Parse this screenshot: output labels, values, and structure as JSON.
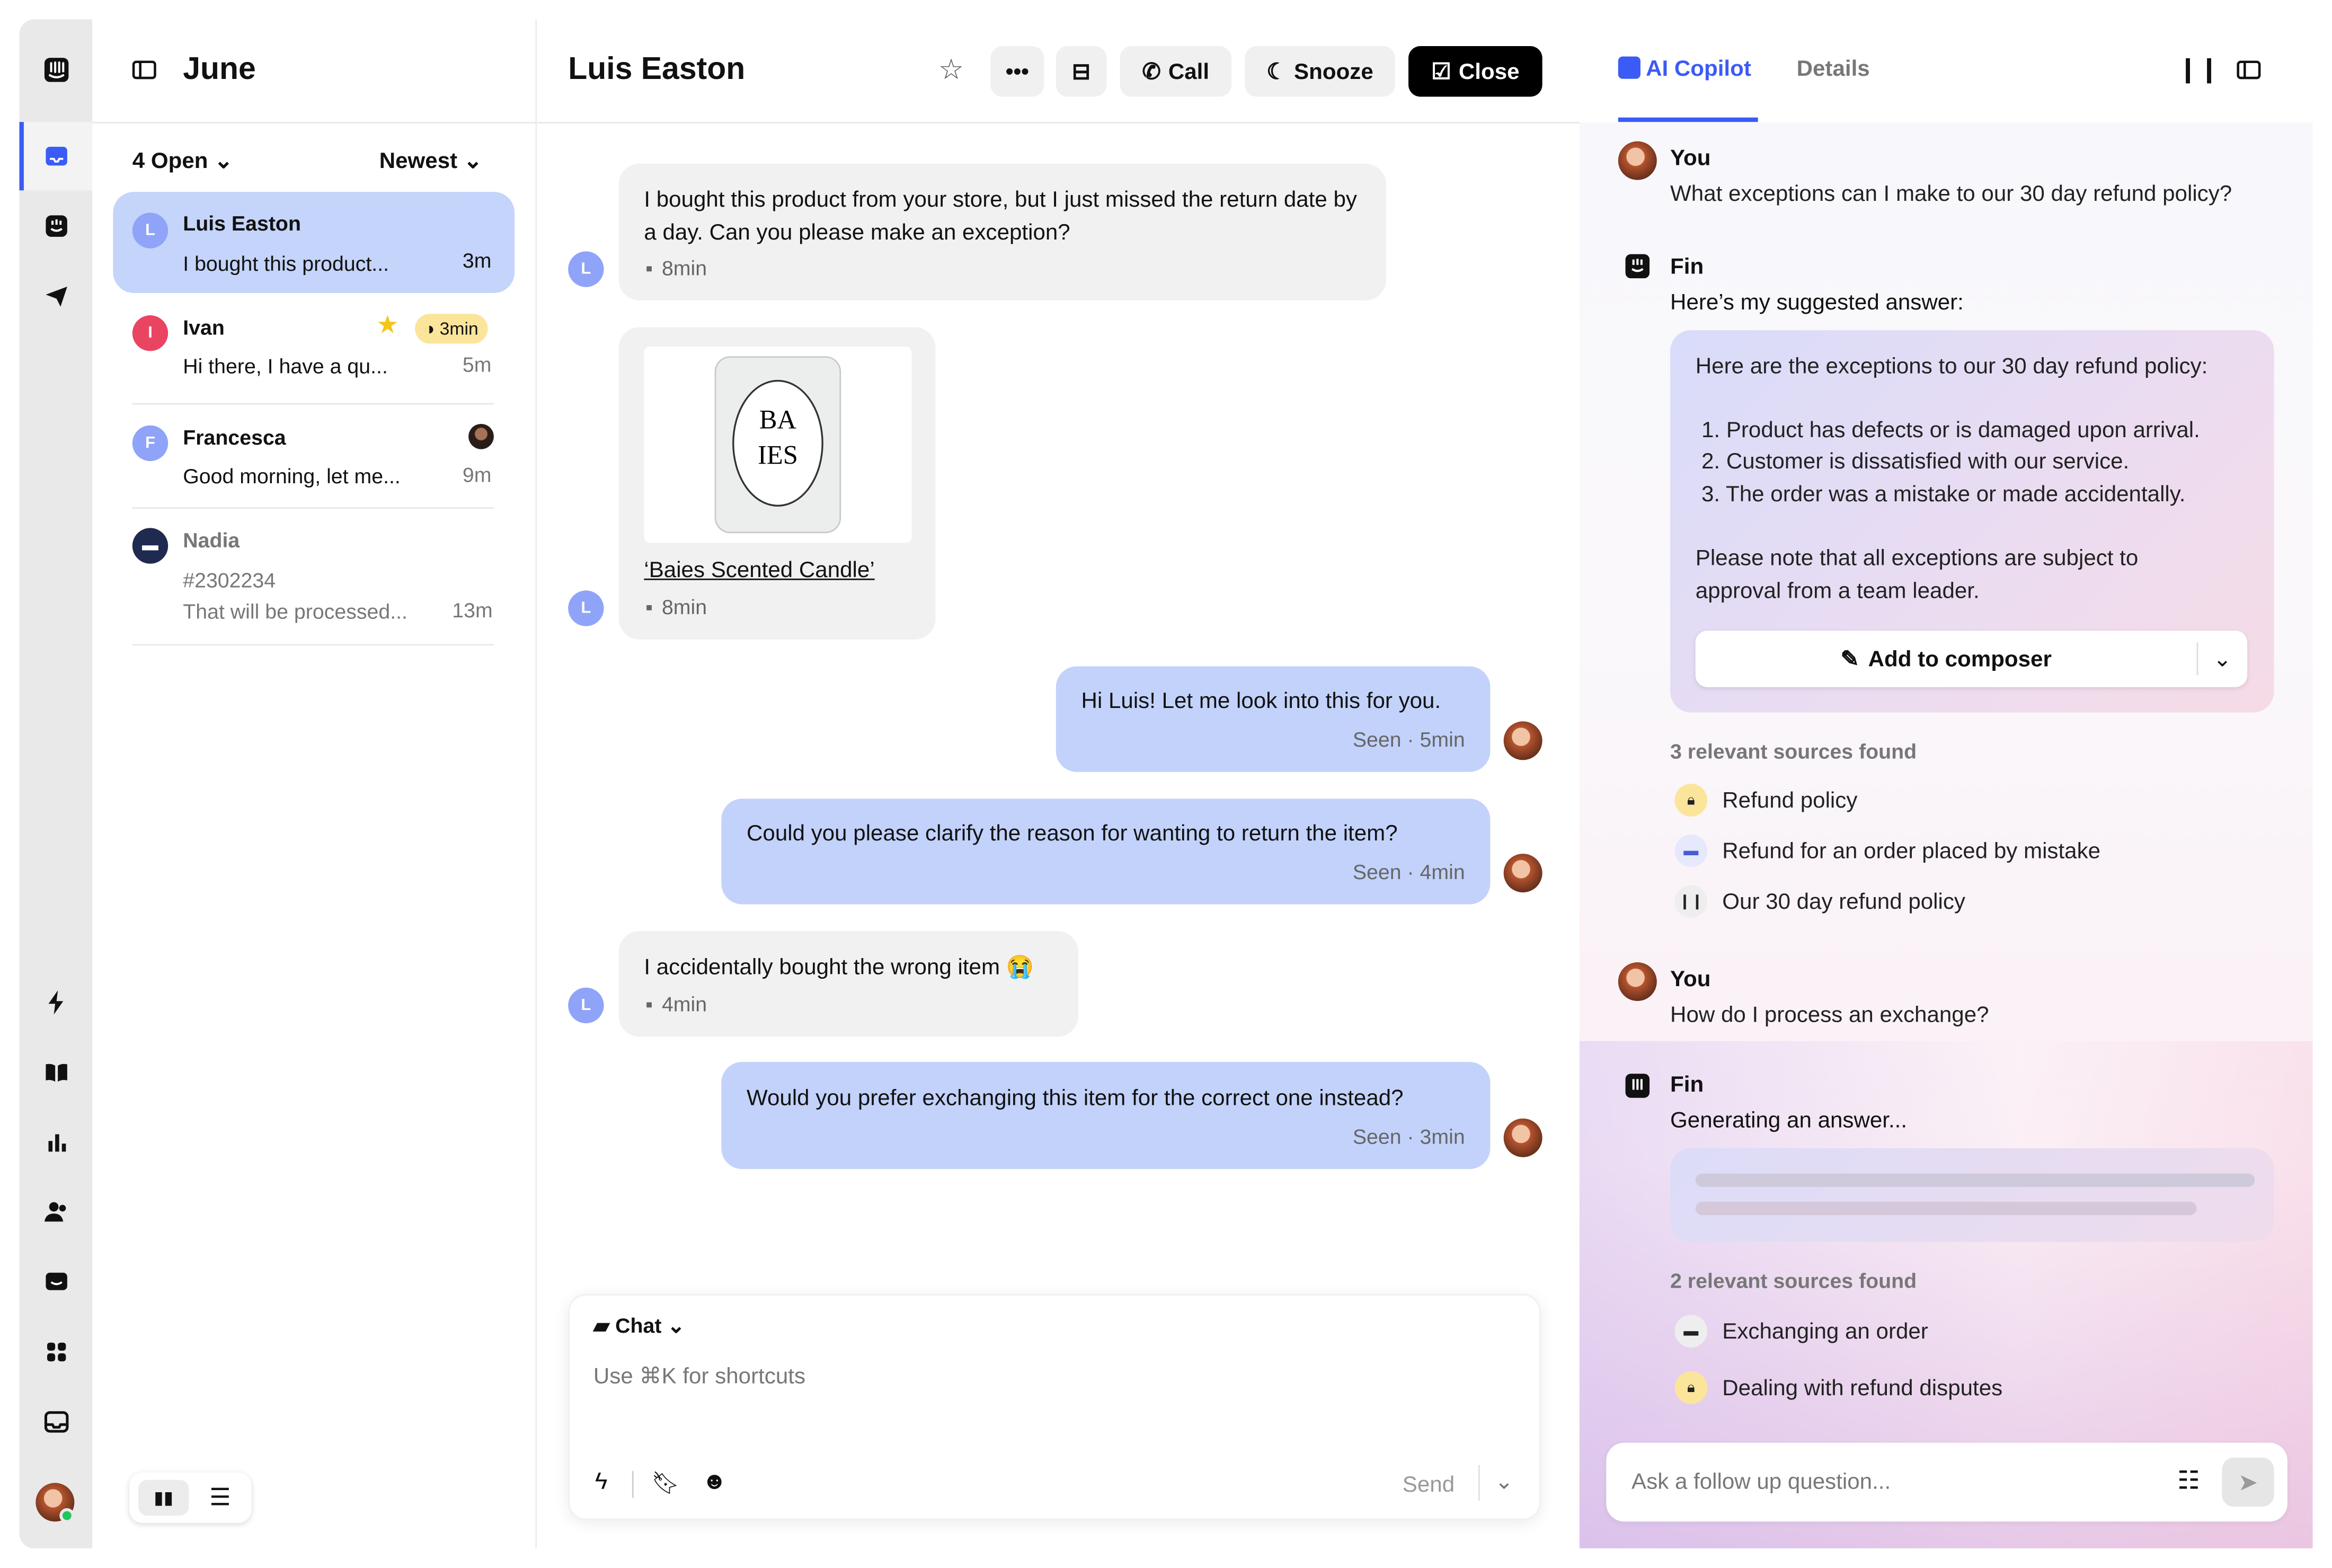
{
  "inbox": {
    "title": "June",
    "filter": "4 Open",
    "sort": "Newest",
    "conversations": [
      {
        "initial": "L",
        "name": "Luis Easton",
        "preview": "I bought this product...",
        "time": "3m",
        "color": "#8fa4f8"
      },
      {
        "initial": "I",
        "name": "Ivan",
        "preview": "Hi there, I have a qu...",
        "time": "5m",
        "color": "#e94462",
        "sla": "3min"
      },
      {
        "initial": "F",
        "name": "Francesca",
        "preview": "Good morning, let me...",
        "time": "9m",
        "color": "#8fa4f8"
      },
      {
        "name": "Nadia",
        "ticket": "#2302234",
        "preview": "That will be processed...",
        "time": "13m",
        "color": "#1f2a50"
      }
    ]
  },
  "conversation": {
    "title": "Luis Easton",
    "call": "Call",
    "snooze": "Snooze",
    "close": "Close",
    "messages": [
      {
        "from": "customer",
        "text": "I bought this product from your store, but I just missed the return date by a day. Can you please make an exception?",
        "time": "8min"
      },
      {
        "from": "customer",
        "link": "‘Baies Scented Candle’",
        "time": "8min"
      },
      {
        "from": "agent",
        "text": "Hi Luis! Let me look into this for you.",
        "status": "Seen · 5min"
      },
      {
        "from": "agent",
        "text": "Could you please clarify the reason for wanting to return the item?",
        "status": "Seen · 4min"
      },
      {
        "from": "customer",
        "text": "I accidentally bought the wrong item 😭",
        "time": "4min"
      },
      {
        "from": "agent",
        "text": "Would you prefer exchanging this item for the correct one instead?",
        "status": "Seen · 3min"
      }
    ],
    "composer": {
      "mode": "Chat",
      "placeholder": "Use ⌘K for shortcuts",
      "send": "Send"
    }
  },
  "copilot": {
    "tab_active": "AI Copilot",
    "tab_other": "Details",
    "q1": {
      "author": "You",
      "text": "What exceptions can I make to our 30 day refund policy?"
    },
    "a1": {
      "author": "Fin",
      "intro": "Here’s my suggested answer:",
      "heading": "Here are the exceptions to our 30 day refund policy:",
      "items": [
        "Product has defects or is damaged upon arrival.",
        "Customer is dissatisfied with our service.",
        "The order was a mistake or made accidentally."
      ],
      "note": "Please note that all exceptions are subject to approval from a team leader.",
      "add": "Add to composer",
      "sources_label": "3 relevant sources found",
      "sources": [
        "Refund policy",
        "Refund for an order placed by mistake",
        "Our 30 day refund policy"
      ]
    },
    "q2": {
      "author": "You",
      "text": "How do I process an exchange?"
    },
    "a2": {
      "author": "Fin",
      "intro": "Generating an answer...",
      "sources_label": "2 relevant sources found",
      "sources": [
        "Exchanging an order",
        "Dealing with refund disputes"
      ]
    },
    "input_placeholder": "Ask a follow up question..."
  },
  "colors": {
    "accent": "#3b5bf6",
    "selected": "#c4d4fb",
    "agent_bubble": "#c2d2fb"
  }
}
